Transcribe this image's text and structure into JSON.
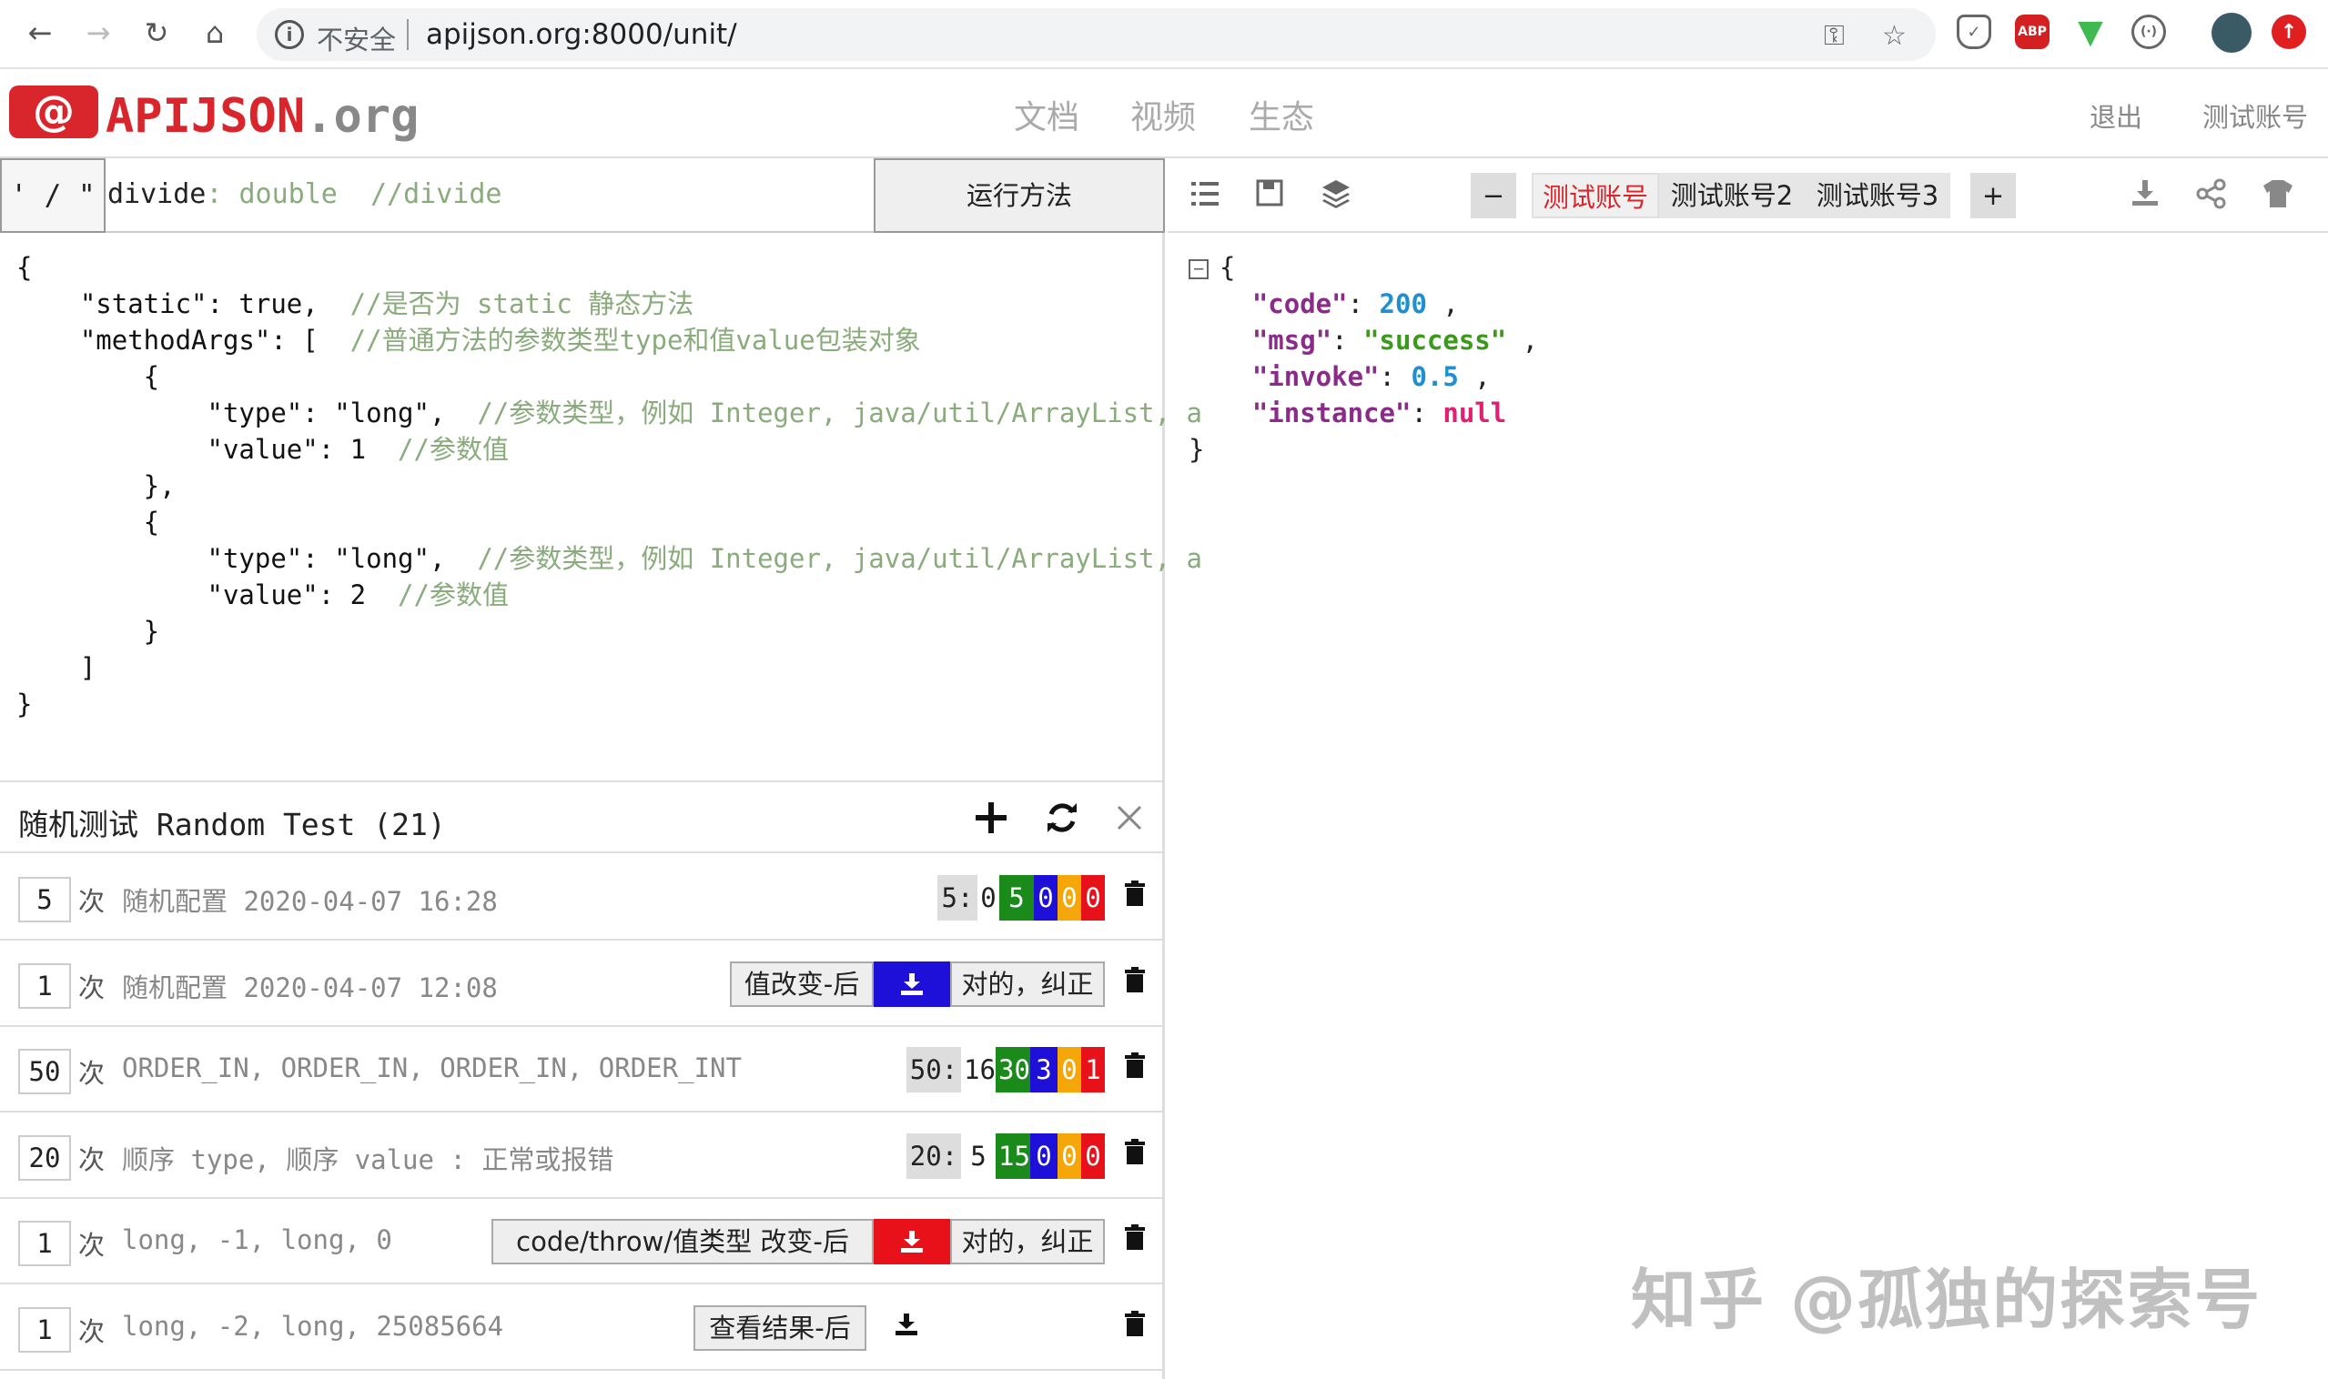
{
  "browser": {
    "insecure_label": "不安全",
    "url": "apijson.org:8000/unit/",
    "extensions": [
      "shield-icon",
      "ABP",
      "vue-icon",
      "glasses-icon"
    ]
  },
  "header": {
    "logo_symbol": "@",
    "logo_text": "APIJSON",
    "logo_suffix": ".org",
    "nav": [
      "文档",
      "视频",
      "生态"
    ],
    "logout": "退出",
    "test_account": "测试账号"
  },
  "method_bar": {
    "separator": "' / \"",
    "method_name": "divide",
    "method_type": ": double",
    "method_comment": "//divide",
    "run_label": "运行方法"
  },
  "code_lines": [
    {
      "code": "{",
      "comment": ""
    },
    {
      "code": "    \"static\": true,  ",
      "comment": "//是否为 static 静态方法"
    },
    {
      "code": "    \"methodArgs\": [  ",
      "comment": "//普通方法的参数类型type和值value包装对象"
    },
    {
      "code": "        {",
      "comment": ""
    },
    {
      "code": "            \"type\": \"long\",  ",
      "comment": "//参数类型，例如 Integer, java/util/ArrayList, a"
    },
    {
      "code": "            \"value\": 1  ",
      "comment": "//参数值"
    },
    {
      "code": "        },",
      "comment": ""
    },
    {
      "code": "        {",
      "comment": ""
    },
    {
      "code": "            \"type\": \"long\",  ",
      "comment": "//参数类型，例如 Integer, java/util/ArrayList, a"
    },
    {
      "code": "            \"value\": 2  ",
      "comment": "//参数值"
    },
    {
      "code": "        }",
      "comment": ""
    },
    {
      "code": "    ]",
      "comment": ""
    },
    {
      "code": "}",
      "comment": ""
    }
  ],
  "random_test": {
    "title": "随机测试 Random Test (21)",
    "rows": [
      {
        "count": "5",
        "unit": "次",
        "name": "随机配置 2020-04-07 16:28",
        "stats": [
          "5:",
          "0",
          "5",
          "0",
          "0",
          "0"
        ]
      },
      {
        "count": "1",
        "unit": "次",
        "name": "随机配置 2020-04-07 12:08",
        "compare": "值改变-后",
        "fix": "对的，纠正",
        "dl_color": "#1e10d8"
      },
      {
        "count": "50",
        "unit": "次",
        "name": "ORDER_IN, ORDER_IN, ORDER_IN, ORDER_INT",
        "stats": [
          "50:",
          "16",
          "30",
          "3",
          "0",
          "1"
        ]
      },
      {
        "count": "20",
        "unit": "次",
        "name": "顺序 type, 顺序 value : 正常或报错",
        "stats": [
          "20:",
          "5",
          "15",
          "0",
          "0",
          "0"
        ]
      },
      {
        "count": "1",
        "unit": "次",
        "name": "long, -1, long, 0",
        "compare": "code/throw/值类型 改变-后",
        "fix": "对的，纠正",
        "dl_color": "#e8111a"
      },
      {
        "count": "1",
        "unit": "次",
        "name": "long, -2, long, 25085664",
        "view": "查看结果-后"
      }
    ]
  },
  "right_toolbar": {
    "minus": "−",
    "accounts": [
      "测试账号",
      "测试账号2",
      "测试账号3"
    ],
    "plus": "+"
  },
  "result": {
    "code": "200",
    "msg": "\"success\"",
    "invoke": "0.5",
    "instance": "null"
  },
  "watermark": "知乎 @孤独的探索号",
  "colors": {
    "brand": "#d9262c",
    "ok": "#1a8a1a",
    "blue": "#1e10d8",
    "warn": "#f5a70a",
    "error": "#e8111a"
  }
}
